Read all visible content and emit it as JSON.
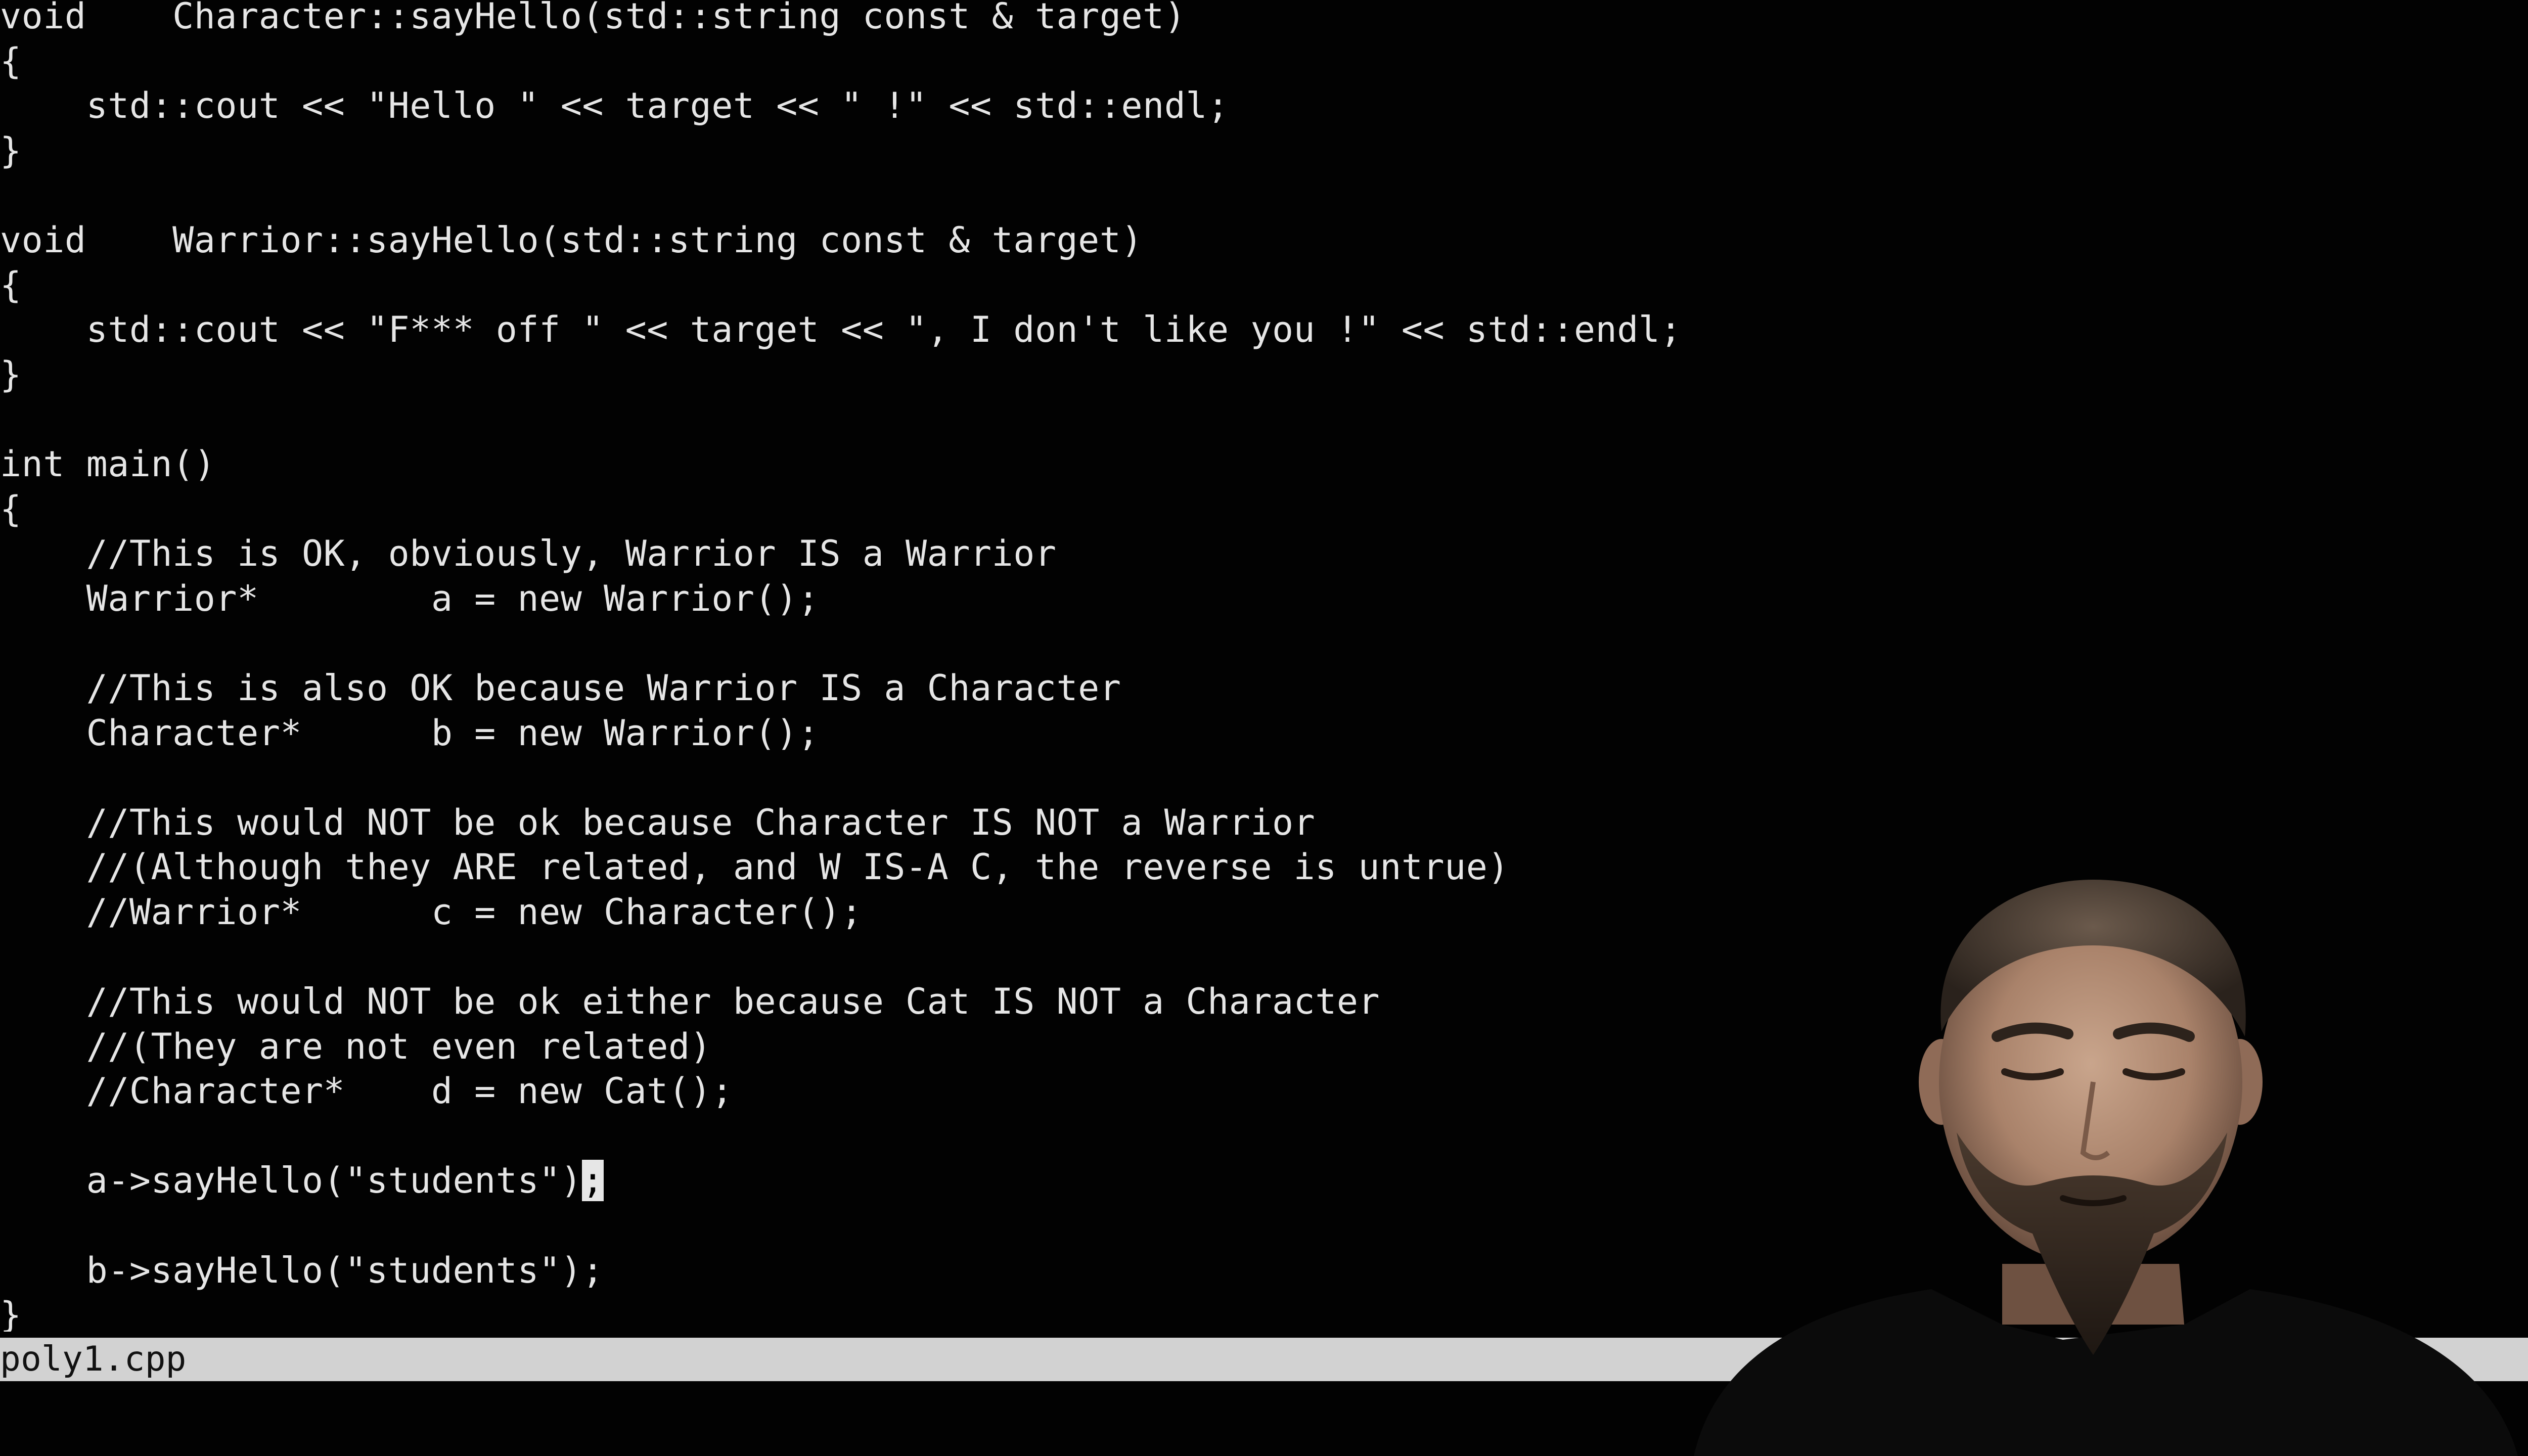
{
  "editor": {
    "lines": [
      "void    Character::sayHello(std::string const & target)",
      "{",
      "    std::cout << \"Hello \" << target << \" !\" << std::endl;",
      "}",
      "",
      "void    Warrior::sayHello(std::string const & target)",
      "{",
      "    std::cout << \"F*** off \" << target << \", I don't like you !\" << std::endl;",
      "}",
      "",
      "int main()",
      "{",
      "    //This is OK, obviously, Warrior IS a Warrior",
      "    Warrior*        a = new Warrior();",
      "",
      "    //This is also OK because Warrior IS a Character",
      "    Character*      b = new Warrior();",
      "",
      "    //This would NOT be ok because Character IS NOT a Warrior",
      "    //(Although they ARE related, and W IS-A C, the reverse is untrue)",
      "    //Warrior*      c = new Character();",
      "",
      "    //This would NOT be ok either because Cat IS NOT a Character",
      "    //(They are not even related)",
      "    //Character*    d = new Cat();",
      "",
      "    a->sayHello(\"students\")",
      "",
      "    b->sayHello(\"students\");",
      "}"
    ],
    "cursor_line": 26,
    "cursor_char": ";"
  },
  "status_bar": {
    "filename": "poly1.cpp"
  },
  "colors": {
    "background": "#000000",
    "text": "#e6e6e6",
    "status_bar": "#d2d2d2",
    "status_text": "#111111"
  }
}
